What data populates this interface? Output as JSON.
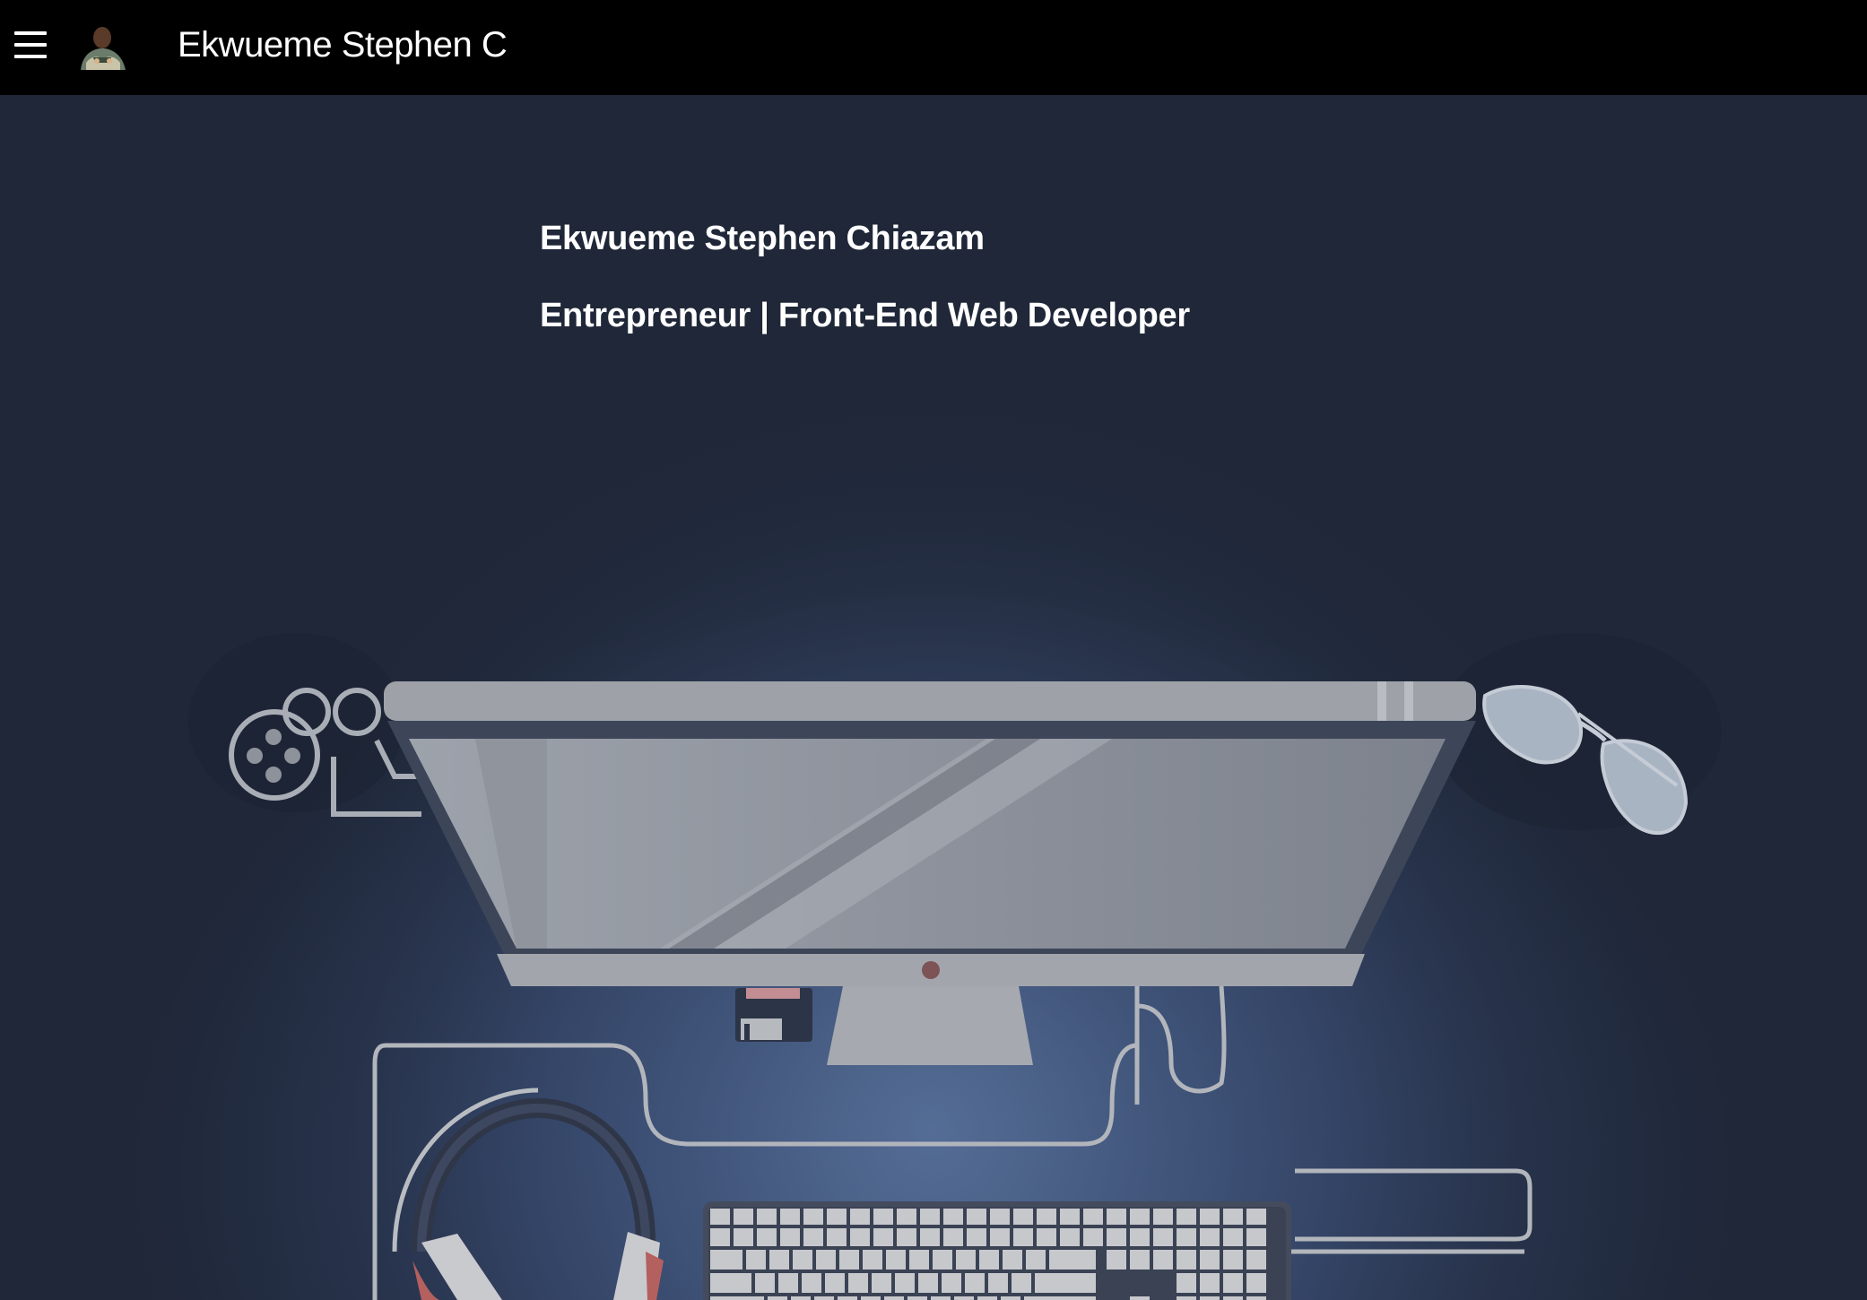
{
  "navbar": {
    "menu_icon": "hamburger-menu-icon",
    "avatar_icon": "profile-avatar",
    "brand": "Ekwueme Stephen C"
  },
  "hero": {
    "name": "Ekwueme Stephen Chiazam",
    "role": "Entrepreneur | Front-End Web Developer",
    "background_illustration": "desk-workspace-illustration"
  },
  "colors": {
    "navbar_bg": "#000000",
    "hero_bg": "#1f2738",
    "text": "#ffffff"
  }
}
